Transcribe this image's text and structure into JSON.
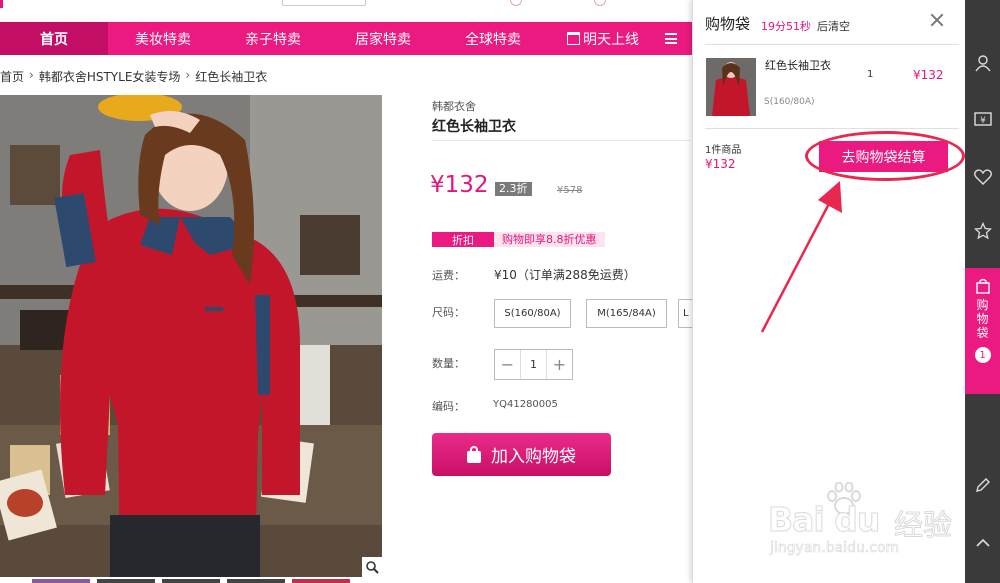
{
  "nav": {
    "items": [
      "首页",
      "美妆特卖",
      "亲子特卖",
      "居家特卖",
      "全球特卖",
      "明天上线"
    ],
    "active_index": 0
  },
  "breadcrumb": [
    "首页",
    "韩都衣舍HSTYLE女装专场",
    "红色长袖卫衣"
  ],
  "product": {
    "brand": "韩都衣舍",
    "title": "红色长袖卫衣",
    "price": "¥132",
    "discount": "2.3折",
    "original_price": "¥578",
    "promo_tag": "折扣",
    "promo_text": "购物即享8.8折优惠",
    "shipping_label": "运费：",
    "shipping_value": "¥10（订单满288免运费）",
    "size_label": "尺码：",
    "sizes": [
      "S(160/80A)",
      "M(165/84A)",
      "L"
    ],
    "qty_label": "数量：",
    "qty_minus": "−",
    "qty_value": "1",
    "qty_plus": "+",
    "code_label": "编码：",
    "code_value": "YQ41280005",
    "add_to_cart": "加入购物袋"
  },
  "cart": {
    "title": "购物袋",
    "timer": "19分51秒",
    "clear_text": "后清空",
    "item": {
      "name": "红色长袖卫衣",
      "qty": "1",
      "price": "¥132",
      "size": "S(160/80A)"
    },
    "count_text": "1件商品",
    "total": "¥132",
    "checkout": "去购物袋结算"
  },
  "sidebar": {
    "cart_label": "购物袋",
    "cart_badge": "1"
  },
  "watermark": {
    "brand": "Bai du",
    "cn": "经验",
    "url": "jingyan.baidu.com"
  },
  "colors": {
    "accent": "#ea1a80",
    "nav_active": "#c40e66",
    "price": "#e5157b",
    "sidebar": "#3a3a3a",
    "annotation": "#e8284e"
  }
}
